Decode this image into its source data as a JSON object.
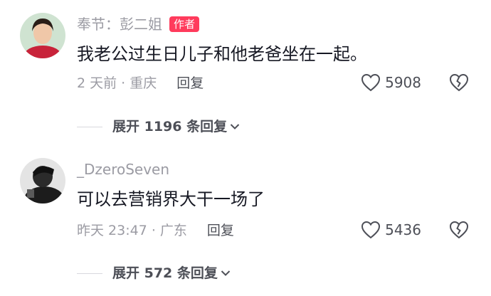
{
  "comments": [
    {
      "username": "奉节：彭二姐",
      "badge": "作者",
      "text": "我老公过生日儿子和他老爸坐在一起。",
      "time_location": "2 天前 · 重庆",
      "reply_label": "回复",
      "likes": "5908",
      "expand_label": "展开 1196 条回复"
    },
    {
      "username": "_DzeroSeven",
      "text": "可以去营销界大干一场了",
      "time_location": "昨天 23:47 · 广东",
      "reply_label": "回复",
      "likes": "5436",
      "expand_label": "展开 572 条回复"
    }
  ],
  "icons": {
    "like": "heart-outline-icon",
    "dislike": "broken-heart-icon",
    "expand": "chevron-down-icon"
  },
  "colors": {
    "badge": "#ff3b5c",
    "meta_text": "#9b9ba3",
    "body_text": "#161823"
  }
}
